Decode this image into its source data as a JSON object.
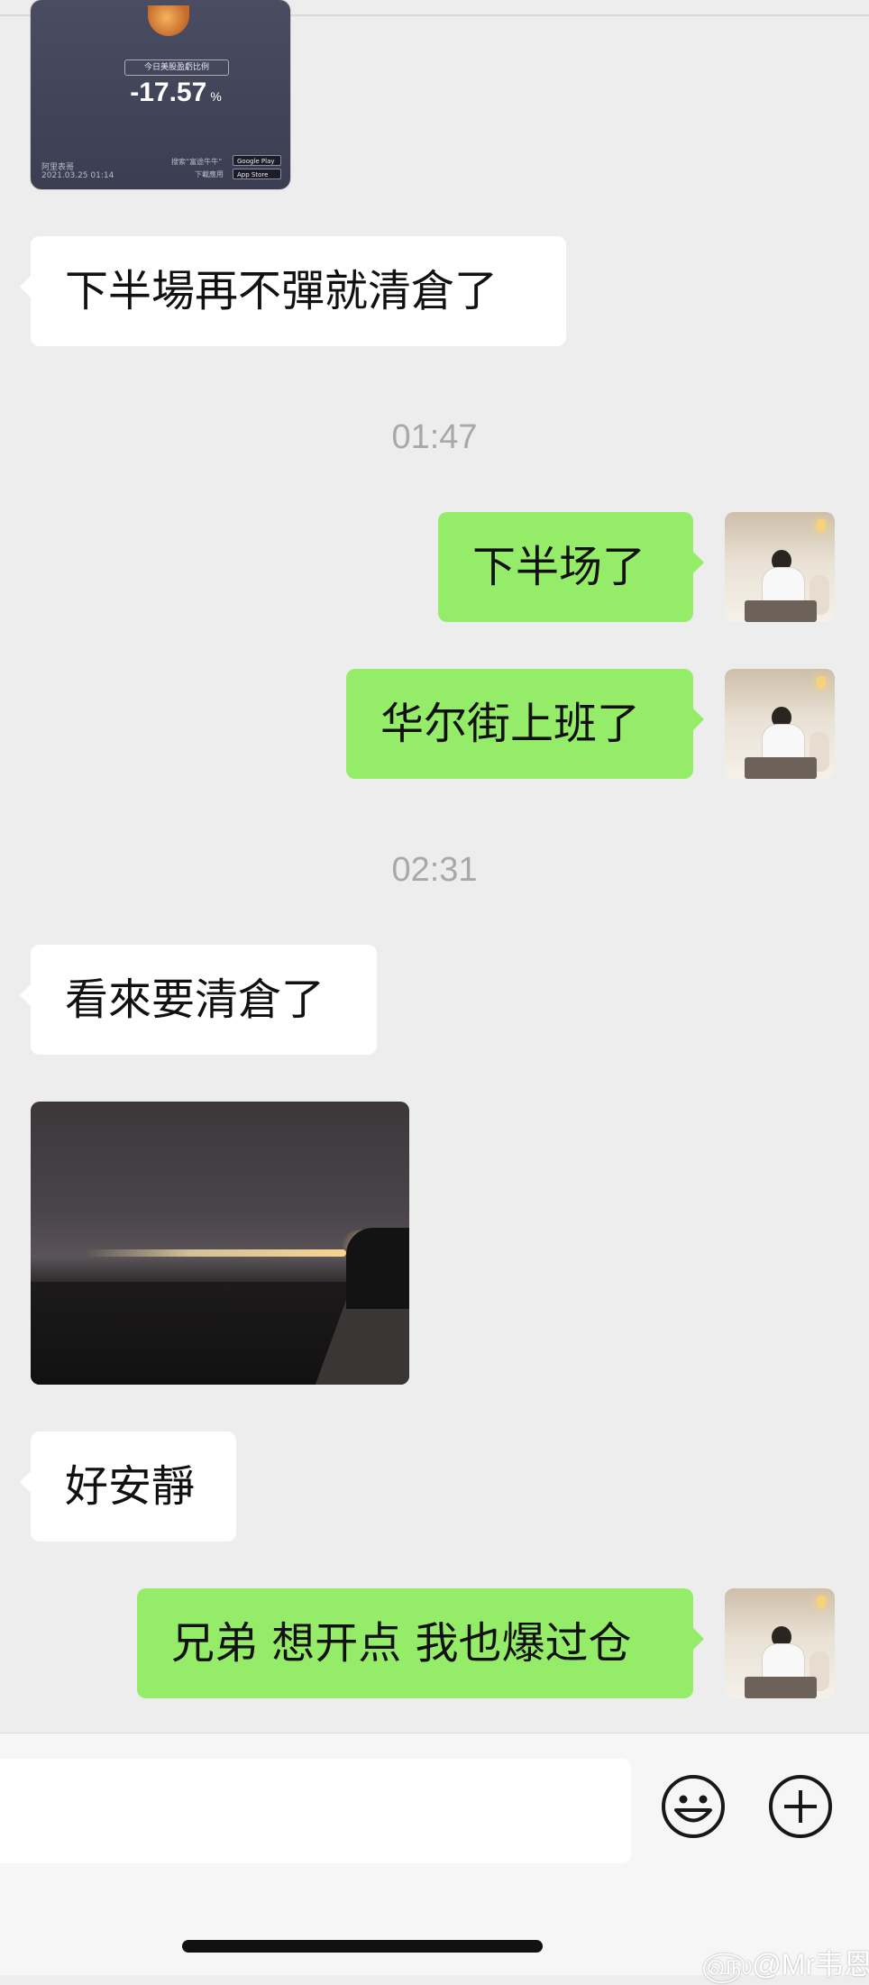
{
  "messages": [
    {
      "card": {
        "badge": "今日美股盈虧比例",
        "value": "-17.57",
        "unit": "%",
        "brand": "阿里表哥",
        "date": "2021.03.25 01:14",
        "search_text": "搜索“富途牛牛”",
        "download_text": "下載應用",
        "store_google": "Google Play",
        "store_apple": "App Store"
      }
    },
    {
      "text": "下半場再不彈就清倉了"
    },
    {
      "timestamp": "01:47"
    },
    {
      "text": "下半场了"
    },
    {
      "text": "华尔街上班了"
    },
    {
      "timestamp": "02:31"
    },
    {
      "text": "看來要清倉了"
    },
    {
      "text": "好安靜"
    },
    {
      "text": "兄弟 想开点 我也爆过仓"
    }
  ],
  "watermark": "@Mr韦恩",
  "colors": {
    "background": "#ededed",
    "incoming_bubble": "#ffffff",
    "outgoing_bubble": "#95ec69",
    "timestamp": "#a8a8a8"
  },
  "icons": [
    "emoji-icon",
    "plus-icon"
  ]
}
